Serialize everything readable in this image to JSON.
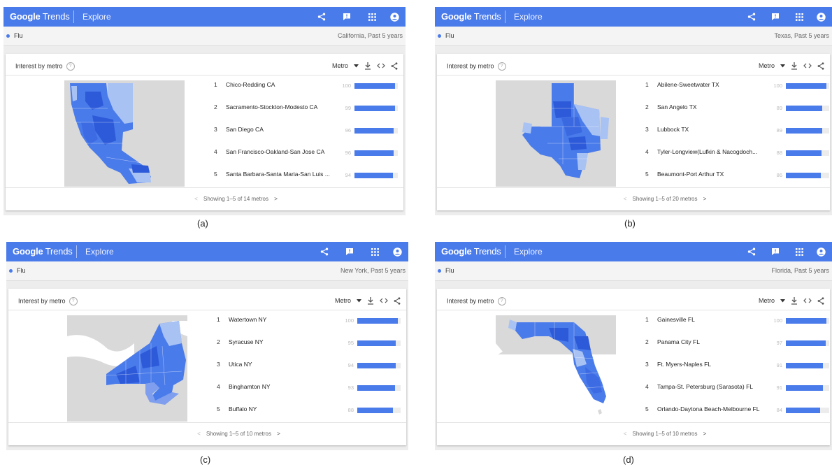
{
  "app": {
    "logo_google": "Google",
    "logo_trends": "Trends",
    "section": "Explore"
  },
  "card": {
    "title": "Interest by metro",
    "metro_label": "Metro",
    "help": "?"
  },
  "colors": {
    "primary": "#4a7bea",
    "light": "#a8c2f4",
    "dark": "#2d5ad9",
    "land": "#d9d9d9",
    "water": "#ffffff"
  },
  "icons": [
    "share-icon",
    "feedback-icon",
    "apps-grid-icon",
    "account-icon",
    "dropdown-arrow-icon",
    "download-icon",
    "embed-code-icon",
    "help-icon"
  ],
  "panels": [
    {
      "caption": "(a)",
      "term": "Flu",
      "region": "California, Past 5 years",
      "pager": "Showing 1–5 of 14 metros",
      "rows": [
        {
          "rank": "1",
          "name": "Chico-Redding CA",
          "value": 100
        },
        {
          "rank": "2",
          "name": "Sacramento-Stockton-Modesto CA",
          "value": 99
        },
        {
          "rank": "3",
          "name": "San Diego CA",
          "value": 96
        },
        {
          "rank": "4",
          "name": "San Francisco-Oakland-San Jose CA",
          "value": 96
        },
        {
          "rank": "5",
          "name": "Santa Barbara-Santa Maria-San Luis ...",
          "value": 94
        }
      ]
    },
    {
      "caption": "(b)",
      "term": "Flu",
      "region": "Texas, Past 5 years",
      "pager": "Showing 1–5 of 20 metros",
      "rows": [
        {
          "rank": "1",
          "name": "Abilene-Sweetwater TX",
          "value": 100
        },
        {
          "rank": "2",
          "name": "San Angelo TX",
          "value": 89
        },
        {
          "rank": "3",
          "name": "Lubbock TX",
          "value": 89
        },
        {
          "rank": "4",
          "name": "Tyler-Longview(Lufkin & Nacogdoch...",
          "value": 88
        },
        {
          "rank": "5",
          "name": "Beaumont-Port Arthur TX",
          "value": 86
        }
      ]
    },
    {
      "caption": "(c)",
      "term": "Flu",
      "region": "New York, Past 5 years",
      "pager": "Showing 1–5 of 10 metros",
      "rows": [
        {
          "rank": "1",
          "name": "Watertown NY",
          "value": 100
        },
        {
          "rank": "2",
          "name": "Syracuse NY",
          "value": 95
        },
        {
          "rank": "3",
          "name": "Utica NY",
          "value": 94
        },
        {
          "rank": "4",
          "name": "Binghamton NY",
          "value": 93
        },
        {
          "rank": "5",
          "name": "Buffalo NY",
          "value": 88
        }
      ]
    },
    {
      "caption": "(d)",
      "term": "Flu",
      "region": "Florida, Past 5 years",
      "pager": "Showing 1–5 of 10 metros",
      "rows": [
        {
          "rank": "1",
          "name": "Gainesville FL",
          "value": 100
        },
        {
          "rank": "2",
          "name": "Panama City FL",
          "value": 97
        },
        {
          "rank": "3",
          "name": "Ft. Myers-Naples FL",
          "value": 91
        },
        {
          "rank": "4",
          "name": "Tampa-St. Petersburg (Sarasota) FL",
          "value": 91
        },
        {
          "rank": "5",
          "name": "Orlando-Daytona Beach-Melbourne FL",
          "value": 84
        }
      ]
    }
  ]
}
